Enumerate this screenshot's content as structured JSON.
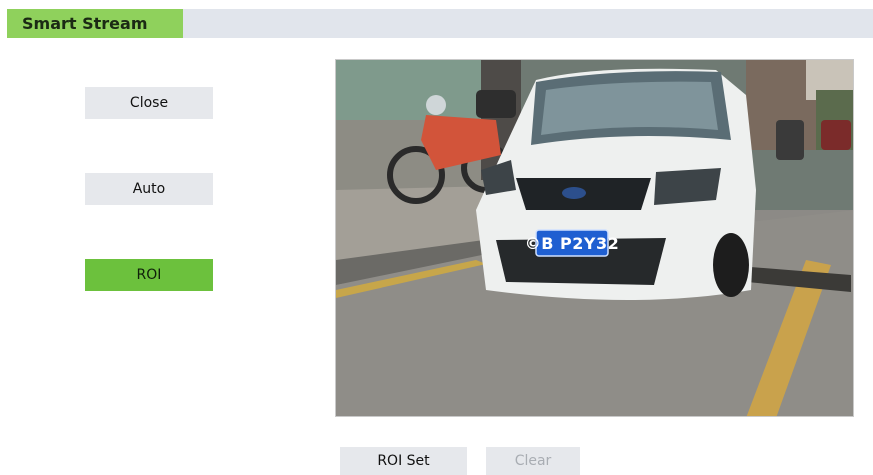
{
  "header": {
    "title": "Smart Stream"
  },
  "modes": {
    "close_label": "Close",
    "auto_label": "Auto",
    "roi_label": "ROI",
    "active": "ROI"
  },
  "preview": {
    "plate": "©B P2Y32"
  },
  "actions": {
    "roi_set_label": "ROI Set",
    "clear_label": "Clear"
  },
  "colors": {
    "header_accent": "#8fd15c",
    "header_bar": "#e1e5ec",
    "active_button": "#6cc13d",
    "button_bg": "#e6e8ec",
    "disabled_text": "#a9adb3"
  }
}
